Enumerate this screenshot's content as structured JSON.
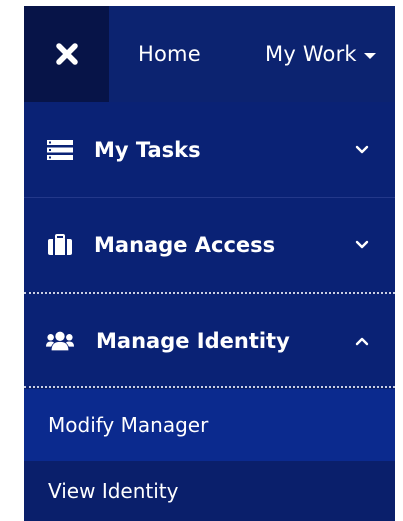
{
  "topbar": {
    "close_icon": "close-x-icon",
    "home_label": "Home",
    "mywork_label": "My Work"
  },
  "menu": {
    "items": [
      {
        "label": "My Tasks",
        "icon": "tasks-list-icon",
        "expanded": false
      },
      {
        "label": "Manage Access",
        "icon": "briefcase-icon",
        "expanded": false
      },
      {
        "label": "Manage Identity",
        "icon": "users-icon",
        "expanded": true
      }
    ],
    "submenu": [
      {
        "label": "Modify Manager",
        "active": true
      },
      {
        "label": "View Identity",
        "active": false
      }
    ]
  },
  "colors": {
    "nav_bg": "#0a1f6b",
    "close_bg": "#071448",
    "active_item_bg": "#0b2a8e",
    "text": "#ffffff"
  }
}
